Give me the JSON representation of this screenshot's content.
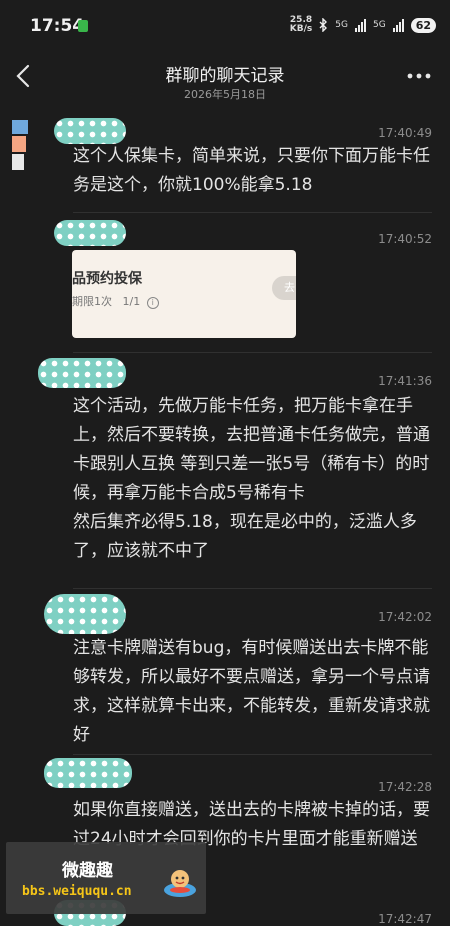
{
  "status_bar": {
    "time": "17:54",
    "net_speed_value": "25.8",
    "net_speed_unit": "KB/s",
    "sim1": "5G",
    "sim2": "5G",
    "battery": "62"
  },
  "header": {
    "title": "群聊的聊天记录",
    "date": "2026年5月18日",
    "back_icon": "chevron-left-icon",
    "more_icon": "more-horizontal-icon"
  },
  "messages": [
    {
      "time": "17:40:49",
      "text": "这个人保集卡，简单来说，只要你下面万能卡任务是这个，你就100%能拿5.18"
    },
    {
      "time": "17:40:52",
      "card": {
        "title": "品预约投保",
        "limit": "期限1次",
        "progress": "1/1",
        "button": "去"
      }
    },
    {
      "time": "17:41:36",
      "text": "这个活动，先做万能卡任务，把万能卡拿在手上，然后不要转换，去把普通卡任务做完，普通卡跟别人互换 等到只差一张5号（稀有卡）的时候，再拿万能卡合成5号稀有卡\n然后集齐必得5.18，现在是必中的，泛滥人多了，应该就不中了"
    },
    {
      "time": "17:42:02",
      "text": "注意卡牌赠送有bug，有时候赠送出去卡牌不能够转发，所以最好不要点赠送，拿另一个号点请求，这样就算卡出来，不能转发，重新发请求就好"
    },
    {
      "time": "17:42:28",
      "text": "如果你直接赠送，送出去的卡牌被卡掉的话，要过24小时才会回到你的卡片里面才能重新赠送"
    },
    {
      "time": "17:42:47"
    }
  ],
  "watermark": {
    "name": "微趣趣",
    "url": "bbs.weiququ.cn"
  },
  "colors": {
    "background": "#1c1c1c",
    "avatar_teal": "#7fd0c3",
    "watermark_yellow": "#f5c518"
  }
}
